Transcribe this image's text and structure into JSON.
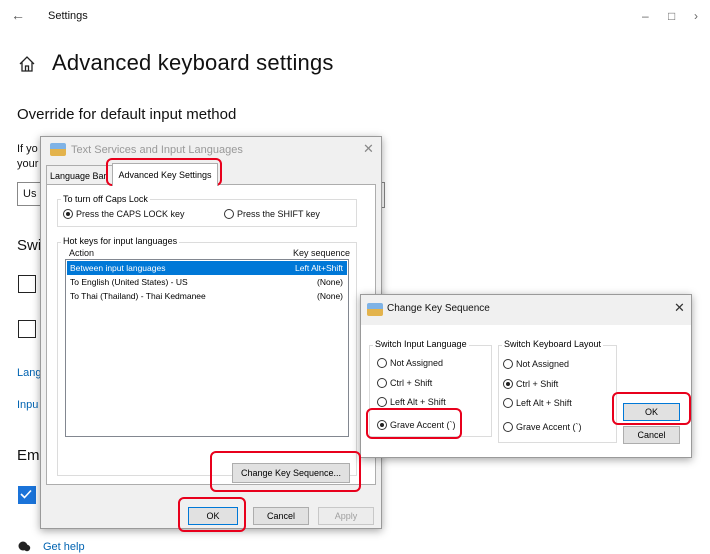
{
  "settings": {
    "window_title": "Settings",
    "page_title": "Advanced keyboard settings",
    "section_override": "Override for default input method",
    "clip_if_you": "If yo",
    "clip_your": "your",
    "clip_us": "Us",
    "clip_switch": "Swi",
    "clip_lang": "Lang",
    "clip_input": "Inpu",
    "clip_emoji": "Em",
    "get_help": "Get help"
  },
  "text_services": {
    "title": "Text Services and Input Languages",
    "tabs": [
      "Language Bar",
      "Advanced Key Settings"
    ],
    "caps_group_label": "To turn off Caps Lock",
    "caps_options": [
      "Press the CAPS LOCK key",
      "Press the SHIFT key"
    ],
    "caps_selected": 0,
    "hotkeys_label": "Hot keys for input languages",
    "col_action": "Action",
    "col_key": "Key sequence",
    "rows": [
      {
        "action": "Between input languages",
        "key": "Left Alt+Shift",
        "selected": true
      },
      {
        "action": "To English (United States) - US",
        "key": "(None)",
        "selected": false
      },
      {
        "action": "To Thai (Thailand) - Thai Kedmanee",
        "key": "(None)",
        "selected": false
      }
    ],
    "change_key_sequence": "Change Key Sequence...",
    "ok": "OK",
    "cancel": "Cancel",
    "apply": "Apply"
  },
  "change_key": {
    "title": "Change Key Sequence",
    "switch_lang_label": "Switch Input Language",
    "switch_layout_label": "Switch Keyboard Layout",
    "lang_options": [
      "Not Assigned",
      "Ctrl + Shift",
      "Left Alt + Shift",
      "Grave Accent (`)"
    ],
    "lang_selected": 3,
    "layout_options": [
      "Not Assigned",
      "Ctrl + Shift",
      "Left Alt + Shift",
      "Grave Accent (`)"
    ],
    "layout_selected": 1,
    "ok": "OK",
    "cancel": "Cancel"
  },
  "colors": {
    "highlight": "#e8001c",
    "selection": "#0078d7",
    "link": "#0063b1"
  }
}
